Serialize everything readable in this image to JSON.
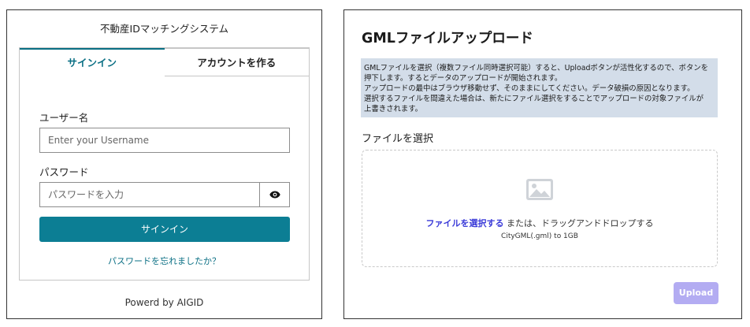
{
  "login": {
    "app_title": "不動産IDマッチングシステム",
    "tabs": [
      {
        "label": "サインイン",
        "active": true
      },
      {
        "label": "アカウントを作る",
        "active": false
      }
    ],
    "username_label": "ユーザー名",
    "username_placeholder": "Enter your Username",
    "username_value": "",
    "password_label": "パスワード",
    "password_placeholder": "パスワードを入力",
    "password_value": "",
    "show_password_icon": "eye-icon",
    "signin_button": "サインイン",
    "forgot_link": "パスワードを忘れましたか？",
    "powered_by": "Powerd by AIGID",
    "accent_color": "#0c7e94"
  },
  "upload": {
    "title": "GMLファイルアップロード",
    "info_lines": [
      "GMLファイルを選択（複数ファイル同時選択可能）すると、Uploadボタンが活性化するので、ボタンを",
      "押下します。するとデータのアップロードが開始されます。",
      "アップロードの最中はブラウザ移動せず、そのままにしてください。データ破損の原因となります。",
      "選択するファイルを間違えた場合は、新たにファイル選択をすることでアップロードの対象ファイルが",
      "上書きされます。"
    ],
    "select_label": "ファイルを選択",
    "dropzone": {
      "icon": "image-icon",
      "link_text": "ファイルを選択する",
      "text_after": " または、ドラッグアンドドロップする",
      "hint": "CityGML(.gml) to 1GB"
    },
    "upload_button": "Upload",
    "upload_button_color": "#b3acf2",
    "info_bg_color": "#d3dde9"
  }
}
